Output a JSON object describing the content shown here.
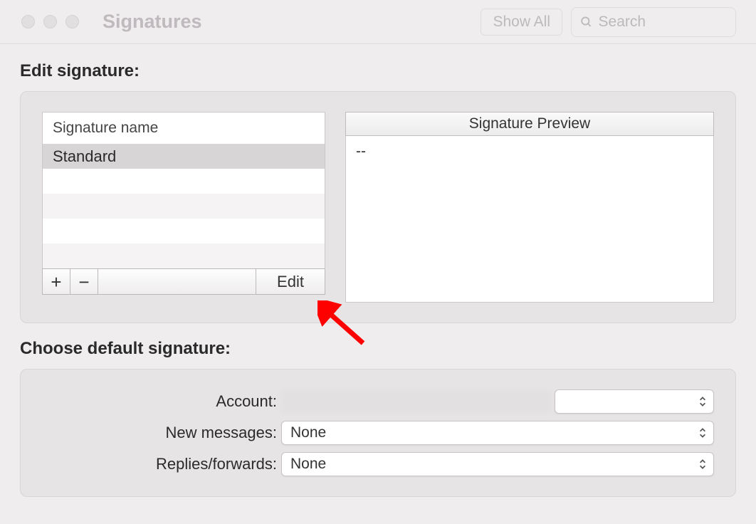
{
  "window": {
    "title": "Signatures",
    "show_all_label": "Show All",
    "search_placeholder": "Search"
  },
  "edit_section": {
    "heading": "Edit signature:",
    "list_header": "Signature name",
    "rows": [
      {
        "name": "Standard",
        "selected": true
      }
    ],
    "toolbar": {
      "add": "+",
      "remove": "−",
      "edit": "Edit"
    },
    "preview": {
      "header": "Signature Preview",
      "body": "--"
    }
  },
  "default_section": {
    "heading": "Choose default signature:",
    "account_label": "Account:",
    "account_value": "",
    "new_messages_label": "New messages:",
    "new_messages_value": "None",
    "replies_label": "Replies/forwards:",
    "replies_value": "None"
  }
}
